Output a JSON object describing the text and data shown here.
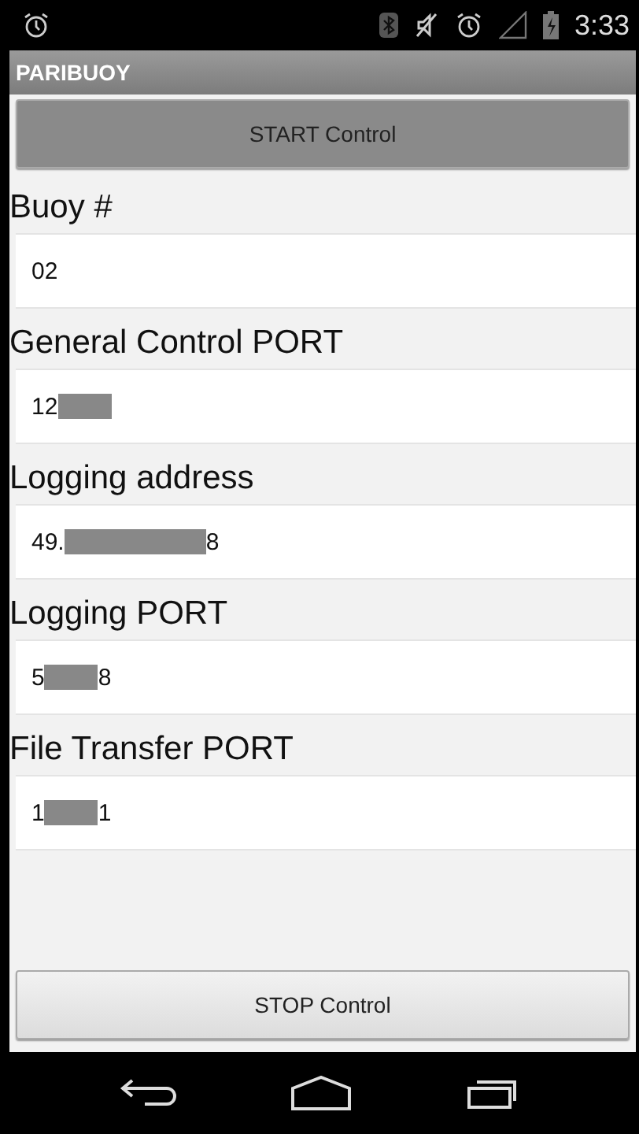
{
  "status_bar": {
    "time": "3:33"
  },
  "app_bar": {
    "title": "PARIBUOY"
  },
  "start_button": "START Control",
  "fields": [
    {
      "label": "Buoy #",
      "before": "02",
      "kind": "plain"
    },
    {
      "label": "General Control PORT",
      "before": "12",
      "kind": "masked"
    },
    {
      "label": "Logging address",
      "before": "49.",
      "after": "8",
      "kind": "widemasked"
    },
    {
      "label": "Logging PORT",
      "before": "5",
      "after": "8",
      "kind": "masked"
    },
    {
      "label": "File Transfer PORT",
      "before": "1",
      "after": "1",
      "kind": "masked"
    }
  ],
  "stop_button": "STOP Control"
}
